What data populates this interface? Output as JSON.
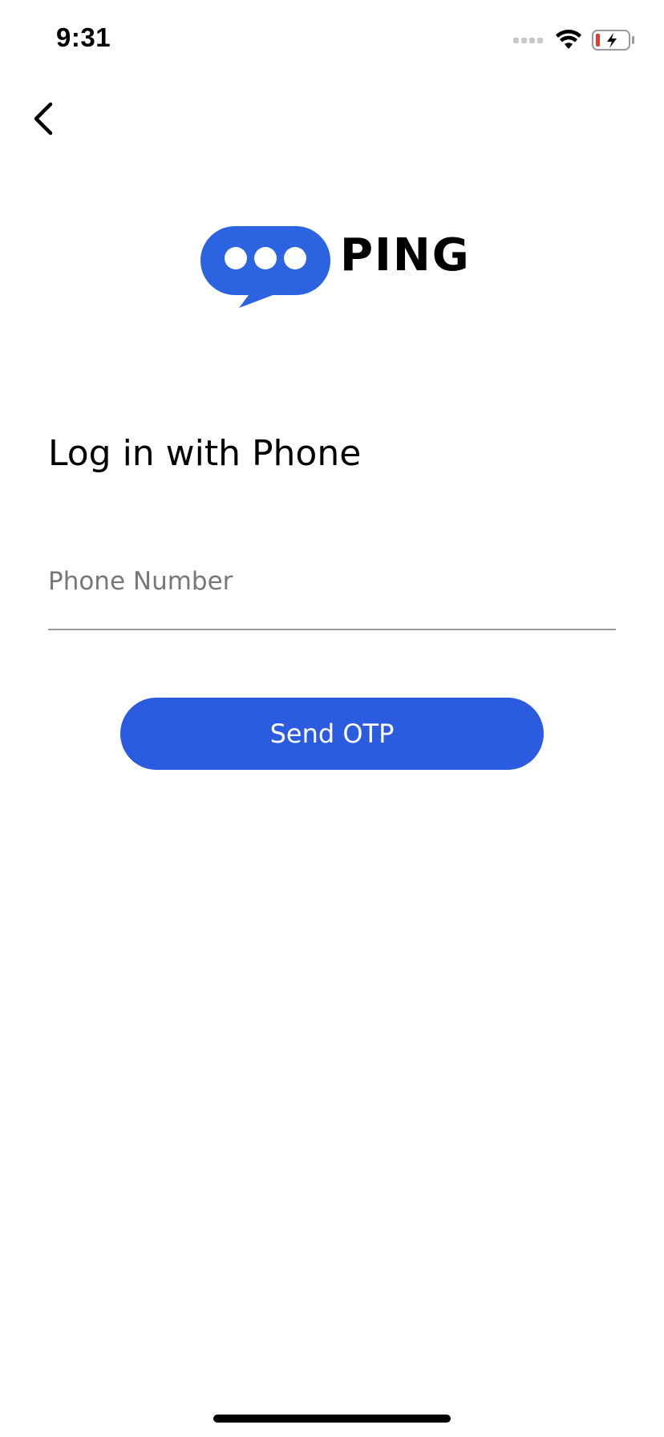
{
  "status_bar": {
    "time": "9:31",
    "icons": [
      "cellular-signal-icon",
      "wifi-icon",
      "battery-charging-icon"
    ],
    "battery_color": "#e53935"
  },
  "nav": {
    "back_icon": "chevron-left-icon"
  },
  "logo": {
    "wordmark": "PING",
    "icon": "chat-bubble-icon",
    "bubble_color": "#2b63e0"
  },
  "login": {
    "heading": "Log in with Phone",
    "phone_value": "",
    "phone_placeholder": "Phone Number",
    "send_label": "Send OTP"
  },
  "colors": {
    "accent": "#2b5ce0",
    "divider": "#9a9a9a",
    "placeholder": "#777777"
  }
}
